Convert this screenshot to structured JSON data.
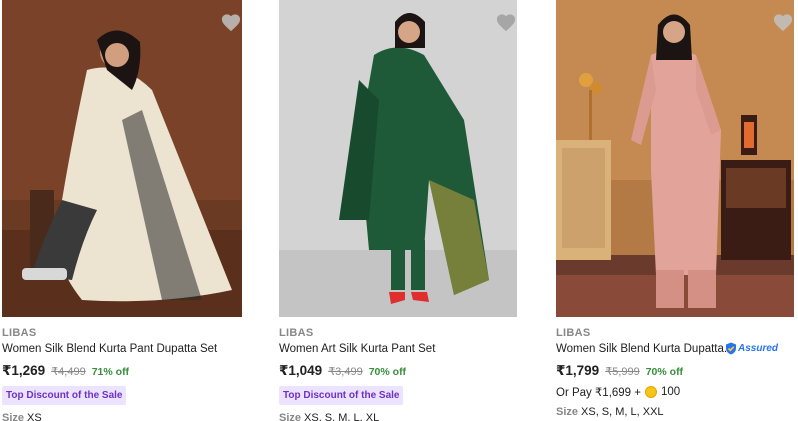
{
  "products": [
    {
      "brand": "LIBAS",
      "title": "Women Silk Blend Kurta Pant Dupatta Set",
      "price": "₹1,269",
      "mrp": "₹4,499",
      "discount": "71% off",
      "offer": "Top Discount of the Sale",
      "size_label": "Size",
      "sizes": "XS"
    },
    {
      "brand": "LIBAS",
      "title": "Women Art Silk Kurta Pant Set",
      "price": "₹1,049",
      "mrp": "₹3,499",
      "discount": "70% off",
      "offer": "Top Discount of the Sale",
      "size_label": "Size",
      "sizes": "XS, S, M, L, XL"
    },
    {
      "brand": "LIBAS",
      "title": "Women Silk Blend Kurta Dupatta...",
      "assured": "Assured",
      "price": "₹1,799",
      "mrp": "₹5,999",
      "discount": "70% off",
      "pay_text": "Or Pay ₹1,699 +",
      "coins": "100",
      "size_label": "Size",
      "sizes": "XS, S, M, L, XXL"
    }
  ],
  "colors": {
    "discount_green": "#388e3c",
    "offer_purple": "#6e31c6",
    "offer_bg": "#ebe3ff",
    "assured_blue": "#2874f0"
  }
}
